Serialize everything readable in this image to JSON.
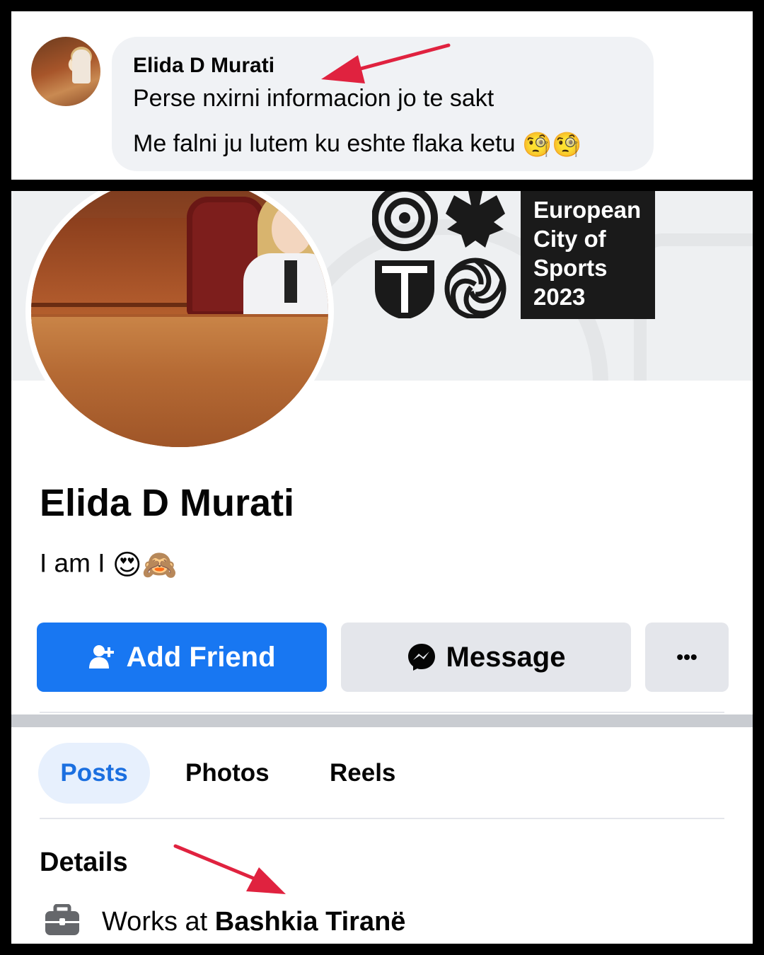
{
  "comment": {
    "author": "Elida D Murati",
    "line1": "Perse nxirni informacion jo te sakt",
    "line2": "Me falni ju lutem ku eshte flaka ketu",
    "line2_emojis": "🧐🧐"
  },
  "cover": {
    "text_lines": [
      "European",
      "City of",
      "Sports",
      "2023"
    ]
  },
  "profile": {
    "name": "Elida D Murati",
    "bio_text": "I am I",
    "bio_emojis": "😍🙈"
  },
  "actions": {
    "add_friend_label": "Add Friend",
    "message_label": "Message",
    "more_label": "•••"
  },
  "tabs": [
    {
      "label": "Posts",
      "active": true
    },
    {
      "label": "Photos",
      "active": false
    },
    {
      "label": "Reels",
      "active": false
    }
  ],
  "details": {
    "title": "Details",
    "work_prefix": "Works at ",
    "work_place": "Bashkia Tiranë"
  },
  "colors": {
    "accent": "#1877f2",
    "annotation_arrow": "#e0223f",
    "button_gray": "#e4e6eb"
  },
  "icons": [
    "add-friend-icon",
    "messenger-icon",
    "more-icon",
    "briefcase-icon"
  ]
}
